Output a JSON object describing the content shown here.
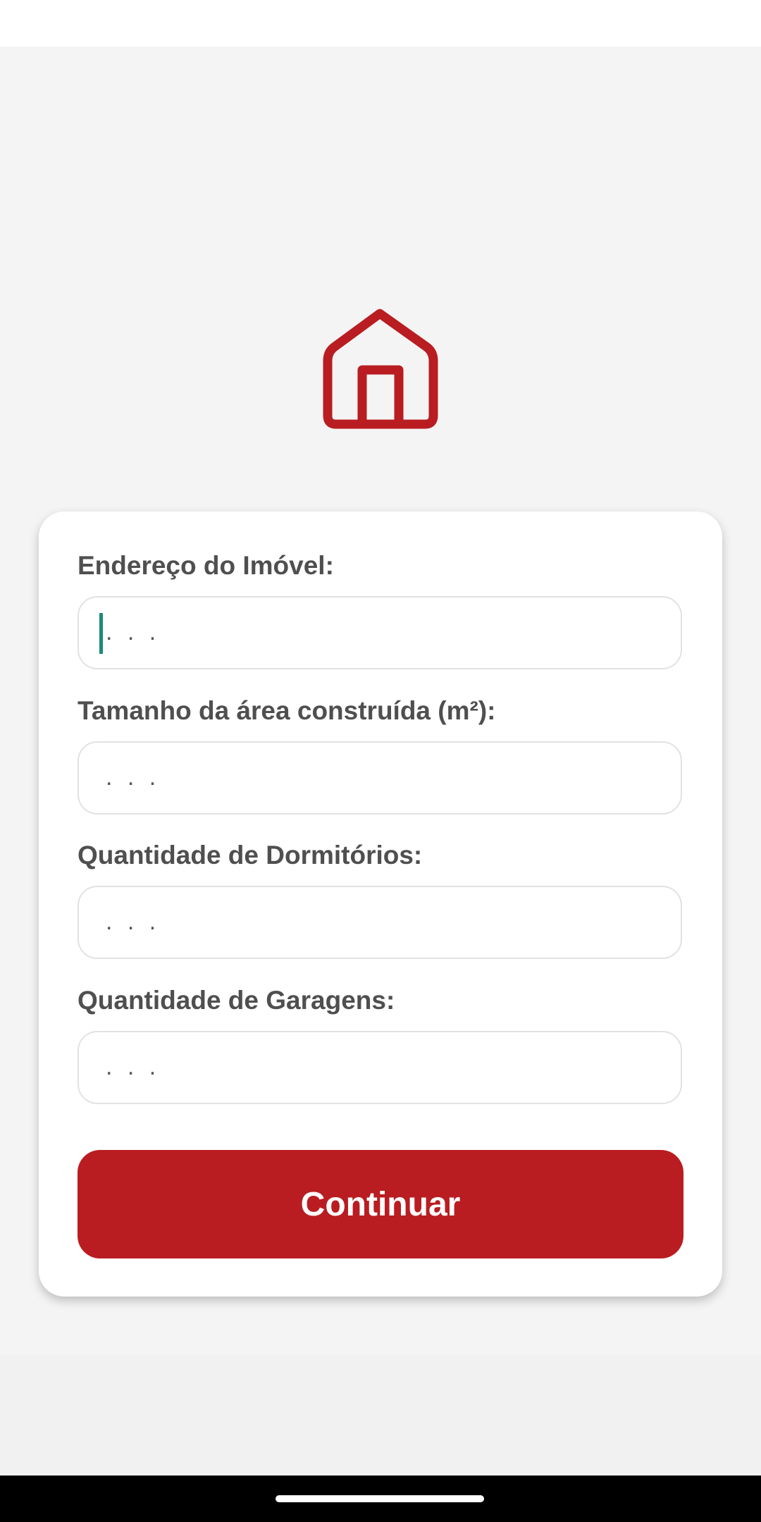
{
  "logo": {
    "icon": "house-icon",
    "color": "#b91d21"
  },
  "form": {
    "fields": [
      {
        "label": "Endereço do Imóvel:",
        "value": "",
        "placeholder": ". . ."
      },
      {
        "label": "Tamanho da área construída (m²):",
        "value": "",
        "placeholder": ". . ."
      },
      {
        "label": "Quantidade de Dormitórios:",
        "value": "",
        "placeholder": ". . ."
      },
      {
        "label": "Quantidade de Garagens:",
        "value": "",
        "placeholder": ". . ."
      }
    ],
    "submit_label": "Continuar"
  },
  "colors": {
    "accent": "#b91d21",
    "caret": "#1b8a7a",
    "label_text": "#4f4f4f"
  }
}
